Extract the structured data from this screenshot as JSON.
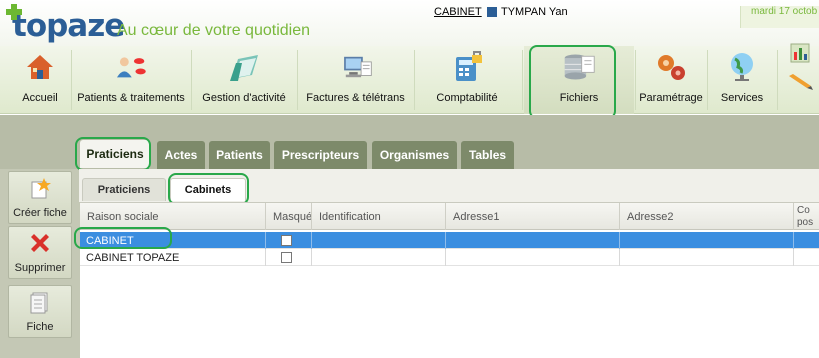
{
  "header": {
    "logo_text": "topaze",
    "tagline": "Au cœur de votre quotidien",
    "cabinet_link": "CABINET",
    "user_name": "TYMPAN Yan",
    "date_text": "mardi 17 octob"
  },
  "toolbar": {
    "items": [
      {
        "label": "Accueil",
        "icon": "house-icon"
      },
      {
        "label": "Patients & traitements",
        "icon": "patient-pills-icon"
      },
      {
        "label": "Gestion d'activité",
        "icon": "folder-icon"
      },
      {
        "label": "Factures & télétrans",
        "icon": "computer-invoice-icon"
      },
      {
        "label": "Comptabilité",
        "icon": "calculator-lock-icon"
      },
      {
        "label": "Fichiers",
        "icon": "database-icon"
      },
      {
        "label": "Paramétrage",
        "icon": "gears-icon"
      },
      {
        "label": "Services",
        "icon": "globe-icon"
      }
    ]
  },
  "side_buttons": [
    {
      "label": "Créer fiche",
      "icon": "new-card-icon"
    },
    {
      "label": "Supprimer",
      "icon": "red-x-icon"
    },
    {
      "label": "Fiche",
      "icon": "document-icon"
    }
  ],
  "tabs": [
    "Praticiens",
    "Actes",
    "Patients",
    "Prescripteurs",
    "Organismes",
    "Tables"
  ],
  "subtabs": [
    "Praticiens",
    "Cabinets"
  ],
  "table": {
    "columns": [
      "Raison sociale",
      "Masqué",
      "Identification",
      "Adresse1",
      "Adresse2",
      "Co pos"
    ],
    "rows": [
      {
        "raison_sociale": "CABINET",
        "masque": false
      },
      {
        "raison_sociale": "CABINET TOPAZE",
        "masque": false
      }
    ]
  },
  "colors": {
    "brand_blue": "#2b5e96",
    "brand_green": "#79b83c",
    "selection_blue": "#3b8ee0",
    "highlight_green": "#29a84a"
  }
}
